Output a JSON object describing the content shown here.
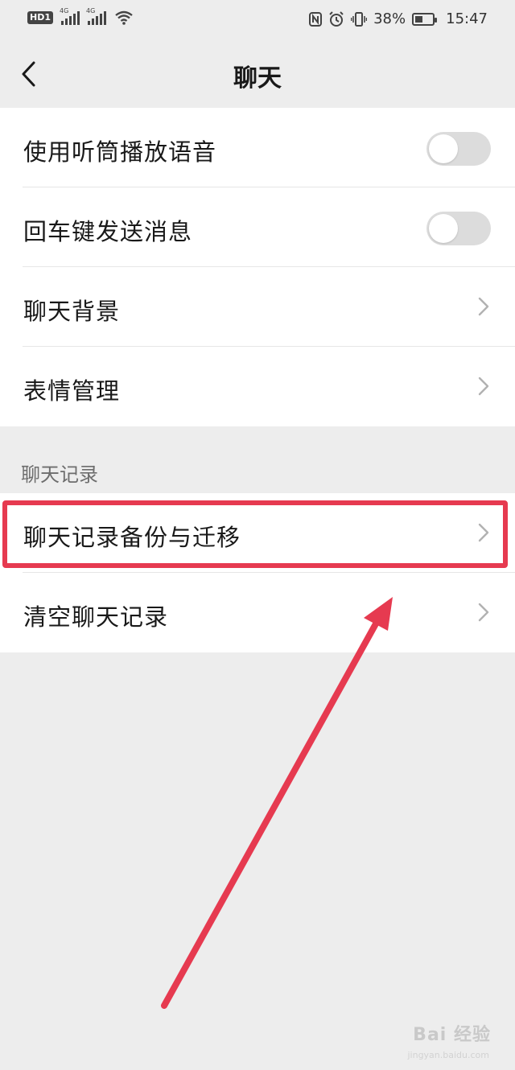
{
  "status_bar": {
    "hd_badge": "HD1",
    "signal_label_1": "4G",
    "signal_label_2": "4G",
    "battery_percent": "38%",
    "time": "15:47"
  },
  "header": {
    "title": "聊天",
    "back_icon": "chevron-left-icon"
  },
  "settings_group_1": {
    "items": [
      {
        "label": "使用听筒播放语音",
        "control": "toggle",
        "on": false
      },
      {
        "label": "回车键发送消息",
        "control": "toggle",
        "on": false
      },
      {
        "label": "聊天背景",
        "control": "chevron"
      },
      {
        "label": "表情管理",
        "control": "chevron"
      }
    ]
  },
  "chat_history_section": {
    "title": "聊天记录",
    "items": [
      {
        "label": "聊天记录备份与迁移",
        "control": "chevron",
        "highlighted": true
      },
      {
        "label": "清空聊天记录",
        "control": "chevron"
      }
    ]
  },
  "annotation": {
    "highlight_color": "#e63a50",
    "arrow_color": "#e63a50"
  },
  "watermark": {
    "text": "Bai 经验",
    "sub": "jingyan.baidu.com"
  },
  "colors": {
    "background": "#ededed",
    "card": "#ffffff",
    "toggle_off": "#dcdcdc",
    "section_text": "#6d6d6d"
  }
}
